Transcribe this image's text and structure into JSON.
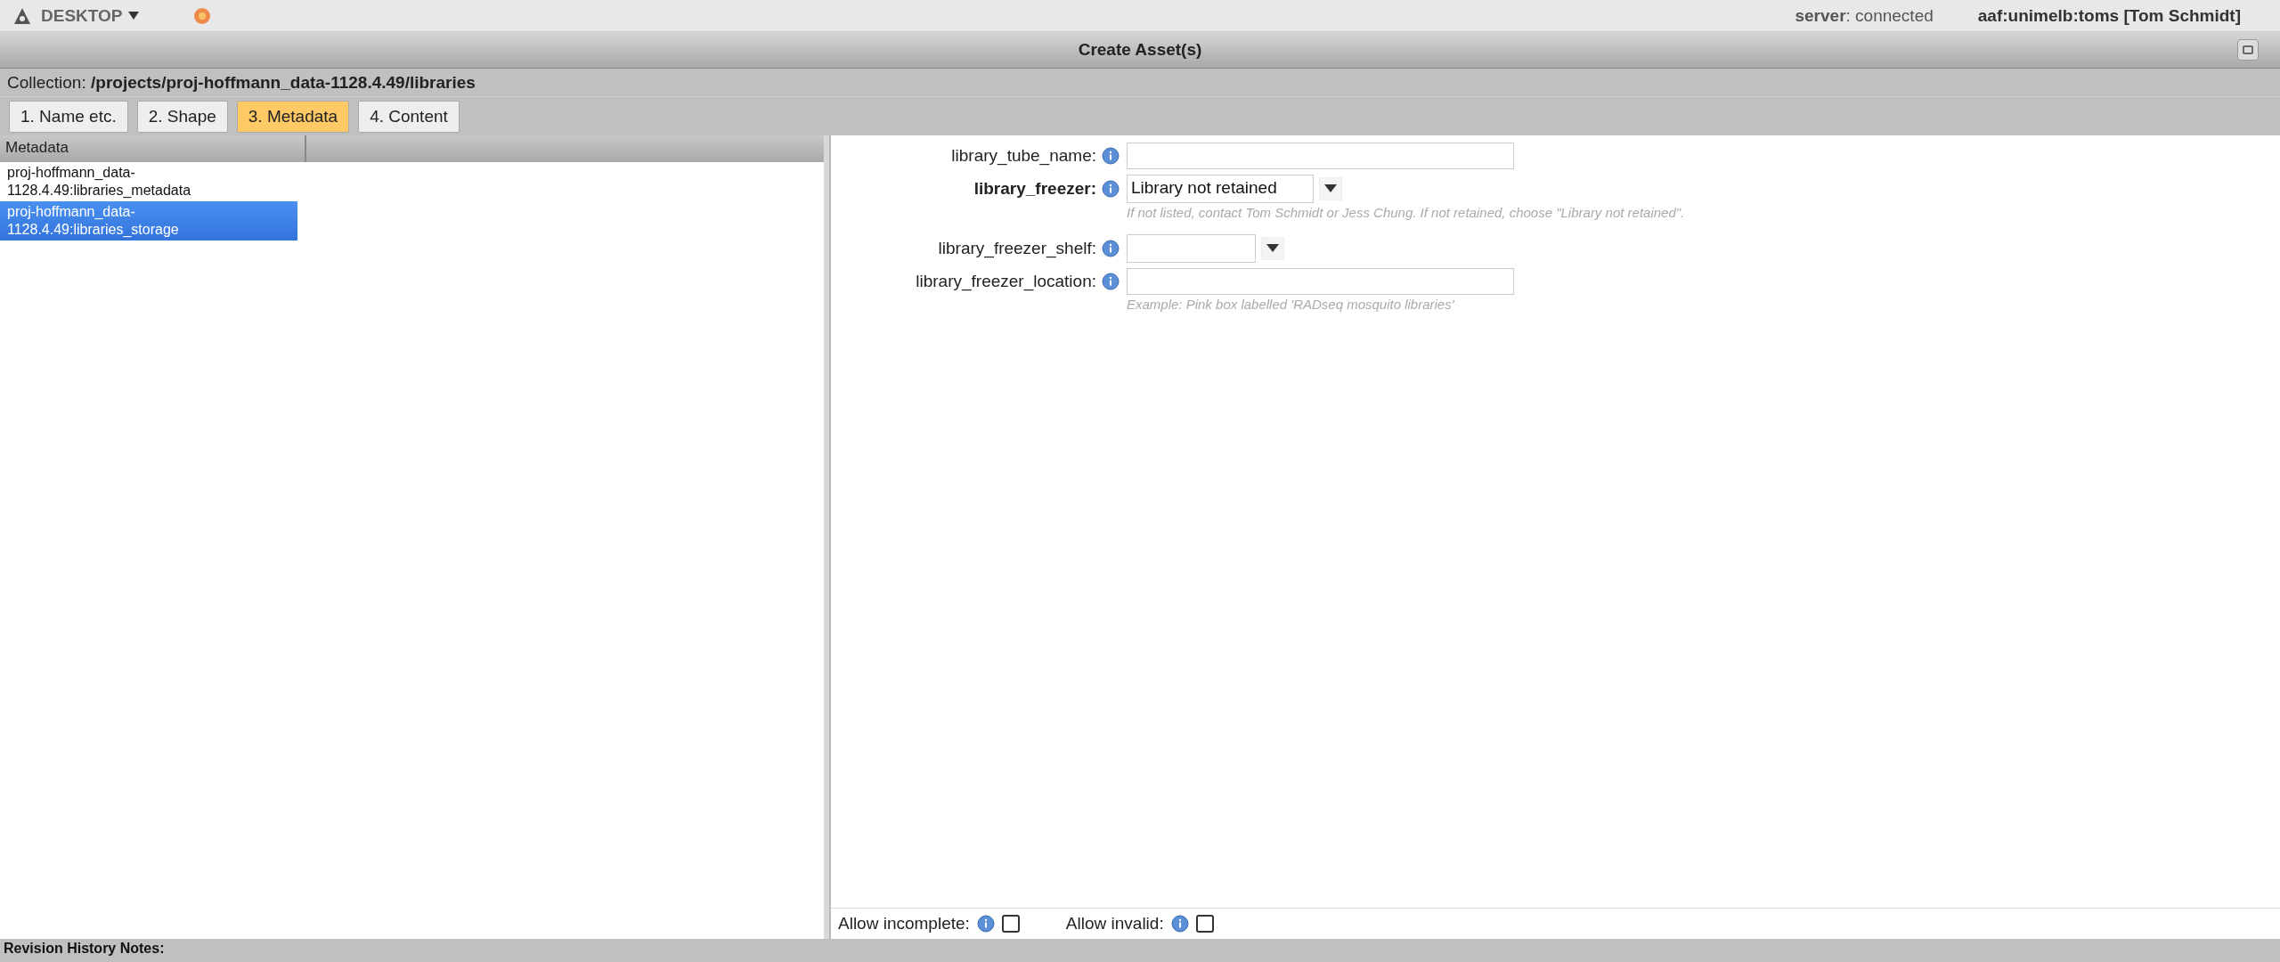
{
  "top_bar": {
    "app_menu": "DESKTOP",
    "server_label": "server",
    "server_status": ": connected",
    "user": "aaf:unimelb:toms [Tom Schmidt]"
  },
  "window": {
    "title": "Create Asset(s)"
  },
  "collection": {
    "label": "Collection:",
    "path": "/projects/proj-hoffmann_data-1128.4.49/libraries"
  },
  "tabs": [
    {
      "label": "1. Name etc.",
      "selected": false
    },
    {
      "label": "2. Shape",
      "selected": false
    },
    {
      "label": "3. Metadata",
      "selected": true
    },
    {
      "label": "4. Content",
      "selected": false
    }
  ],
  "metadata_list": {
    "column": "Metadata",
    "items": [
      {
        "label": "proj-hoffmann_data-\n1128.4.49:libraries_metadata",
        "selected": false
      },
      {
        "label": "proj-hoffmann_data-\n1128.4.49:libraries_storage",
        "selected": true
      }
    ]
  },
  "form": {
    "fields": [
      {
        "kind": "text",
        "label": "library_tube_name:",
        "required": false
      },
      {
        "kind": "select",
        "label": "library_freezer:",
        "required": true,
        "value": "Library not retained",
        "hint": "If not listed, contact Tom Schmidt or Jess Chung. If not retained, choose \"Library not retained\"."
      },
      {
        "kind": "select",
        "label": "library_freezer_shelf:",
        "required": false
      },
      {
        "kind": "text",
        "label": "library_freezer_location:",
        "required": false,
        "hint": "Example: Pink box labelled 'RADseq mosquito libraries'"
      }
    ]
  },
  "options": [
    {
      "label": "Allow incomplete:",
      "checked": false
    },
    {
      "label": "Allow invalid:",
      "checked": false
    }
  ],
  "revision_bar": {
    "label": "Revision History Notes:"
  }
}
